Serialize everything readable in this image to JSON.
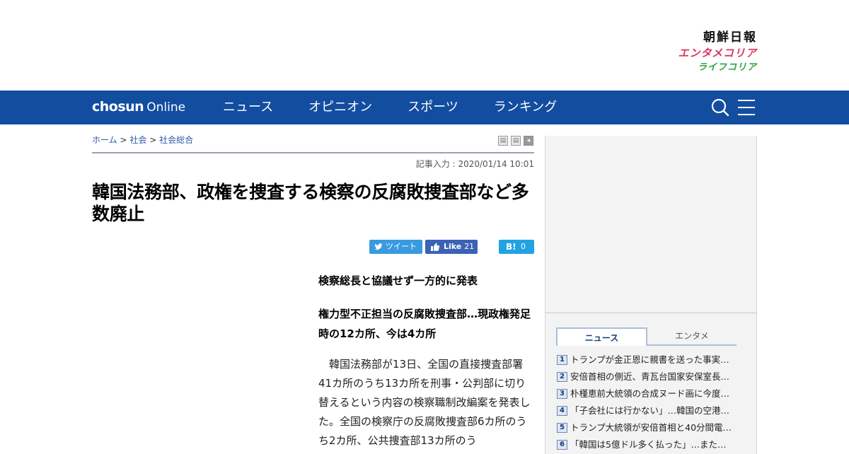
{
  "brands": {
    "main": "朝鮮日報",
    "entame": "エンタメコリア",
    "life": "ライフコリア"
  },
  "nav": {
    "logo_bold": "chosun",
    "logo_light": "Online",
    "menu": [
      "ニュース",
      "オピニオン",
      "スポーツ",
      "ランキング"
    ],
    "icons": [
      "search-icon",
      "hamburger-menu-icon"
    ],
    "background": "#124da0"
  },
  "breadcrumb": {
    "home": "ホーム",
    "sep": ">",
    "section": "社会",
    "subsection": "社会総合"
  },
  "article": {
    "dateline": "記事入力 : 2020/01/14 10:01",
    "headline": "韓国法務部、政権を捜査する検察の反腐敗捜査部など多数廃止",
    "subhead1": "検察総長と協議せず一方的に発表",
    "subhead2": "権力型不正担当の反腐敗捜査部…現政権発足時の12カ所、今は4カ所",
    "body": "韓国法務部が13日、全国の直接捜査部署41カ所のうち13カ所を刑事・公判部に切り替えるという内容の検察職制改編案を発表した。全国の検察庁の反腐敗捜査部6カ所のうち2カ所、公共捜査部13カ所のう"
  },
  "share": {
    "tweet": "ツイート",
    "like": "Like",
    "like_count": "21",
    "hatena": "B!",
    "hatena_count": "0"
  },
  "sidebar": {
    "tabs": [
      "ニュース",
      "エンタメ"
    ],
    "ranking": [
      {
        "rank": "1",
        "title": "トランプが金正恩に親書を送った事実…"
      },
      {
        "rank": "2",
        "title": "安倍首相の側近、青瓦台国家安保室長…"
      },
      {
        "rank": "3",
        "title": "朴槿恵前大統領の合成ヌード画に今度…"
      },
      {
        "rank": "4",
        "title": "「子会社には行かない」…韓国の空港…"
      },
      {
        "rank": "5",
        "title": "トランプ大統領が安倍首相と40分間電…"
      },
      {
        "rank": "6",
        "title": "「韓国は5億ドル多く払った」…また…"
      }
    ]
  }
}
